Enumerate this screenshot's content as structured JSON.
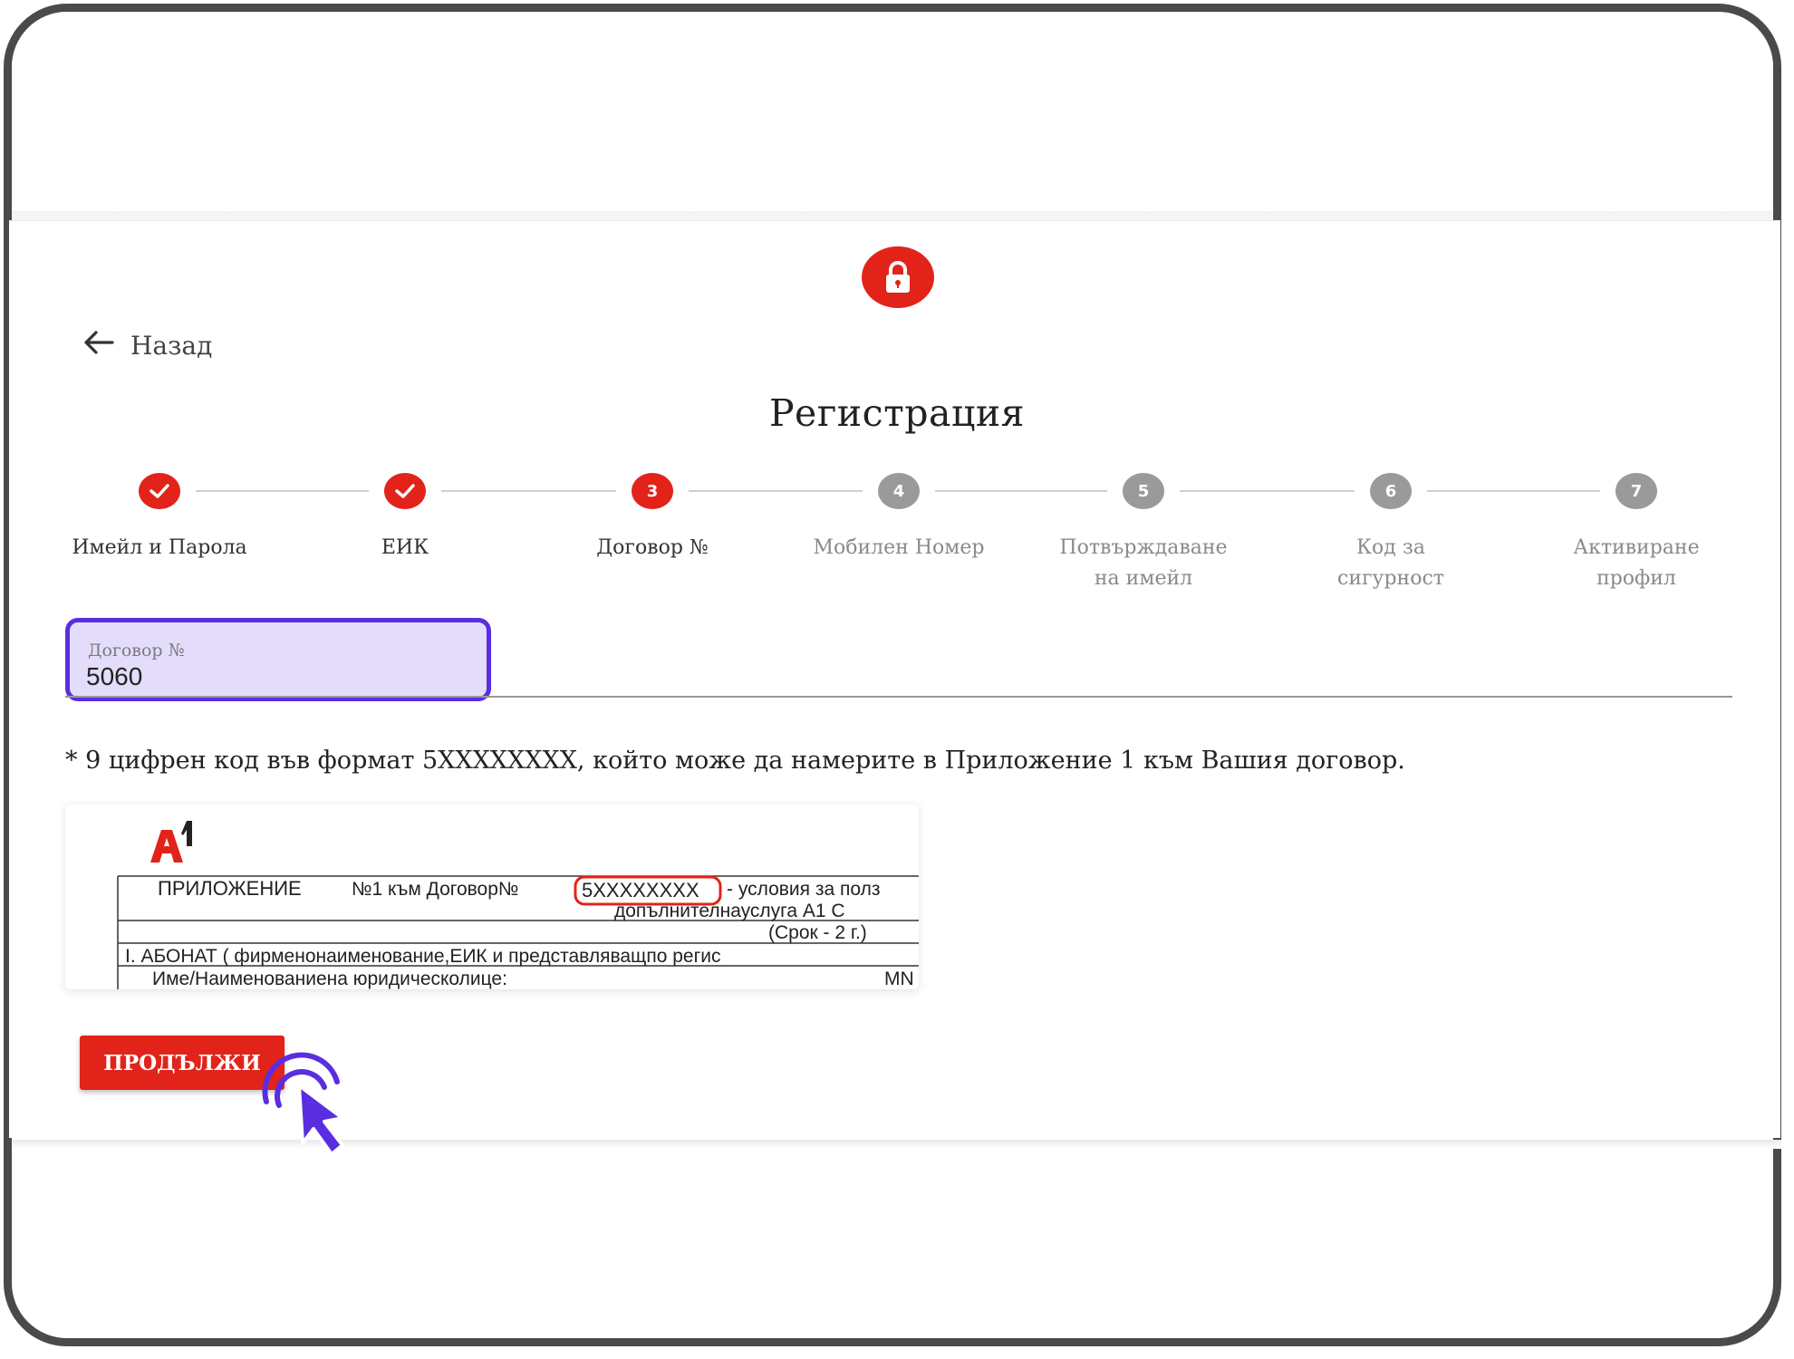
{
  "nav": {
    "back_label": "Назад"
  },
  "page": {
    "title": "Регистрация"
  },
  "steps": [
    {
      "number": "1",
      "label": "Имейл и Парола",
      "state": "done"
    },
    {
      "number": "2",
      "label": "ЕИК",
      "state": "done"
    },
    {
      "number": "3",
      "label": "Договор №",
      "state": "active"
    },
    {
      "number": "4",
      "label": "Мобилен Номер",
      "state": "pending"
    },
    {
      "number": "5",
      "label": "Потвърждаване на имейл",
      "state": "pending"
    },
    {
      "number": "6",
      "label": "Код за сигурност",
      "state": "pending"
    },
    {
      "number": "7",
      "label": "Активиране профил",
      "state": "pending"
    }
  ],
  "contract_field": {
    "label": "Договор №",
    "value": "5060"
  },
  "hint": "* 9 цифрен код във формат 5XXXXXXXX, който може да намерите в Приложение 1 към Вашия договор.",
  "document": {
    "logo": "A1",
    "row1_left": "ПРИЛОЖЕНИЕ",
    "row1_mid": "№1 към Договор№",
    "row1_code": "5XXXXXXXX",
    "row1_right": "- условия за полз",
    "row2": "допълнителнауслуга А1 С",
    "row3": "(Срок - 2 г.)",
    "row4": "I. АБОНАТ  ( фирменонаименование,ЕИК  и представляващпо регис",
    "row5_left": "Име/Наименованиена юридическолице:",
    "row5_right": "МN"
  },
  "continue_button": {
    "label": "ПРОДЪЛЖИ"
  },
  "colors": {
    "accent_red": "#e2231a",
    "highlight_purple": "#5a2ee0",
    "pending_gray": "#9a9a9a"
  },
  "icons": {
    "lock": "lock-icon",
    "back": "arrow-left-icon",
    "check": "check-icon",
    "cursor": "pointer-cursor-icon"
  }
}
